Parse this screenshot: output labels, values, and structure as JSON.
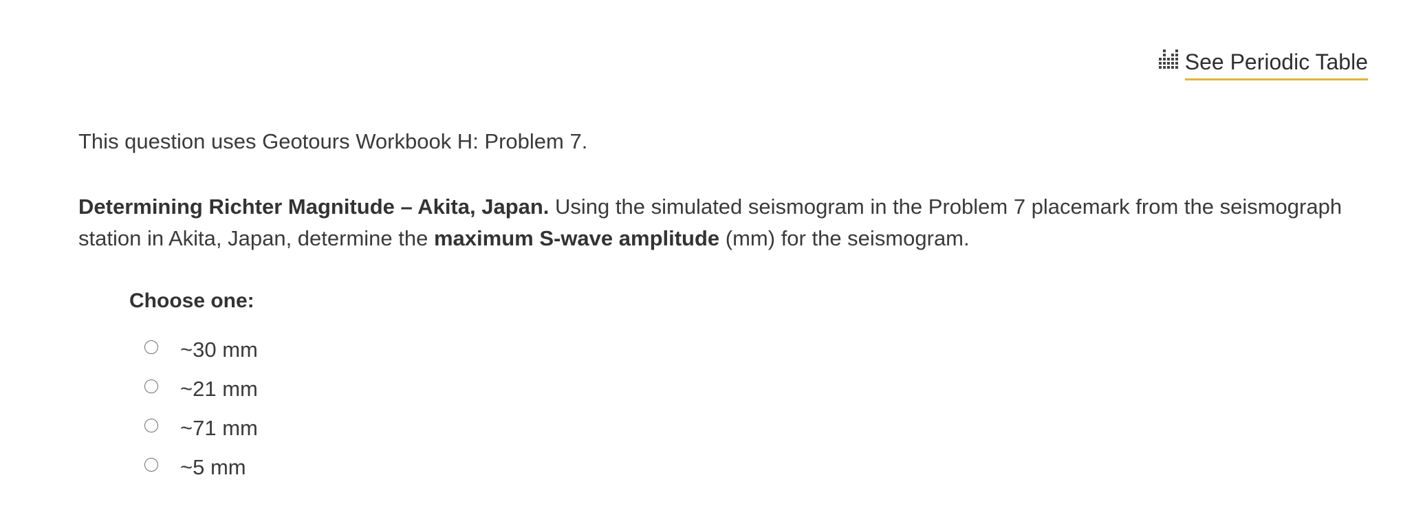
{
  "header": {
    "periodic_table_link": "See Periodic Table"
  },
  "question": {
    "intro": "This question uses Geotours Workbook H: Problem 7.",
    "title_bold": "Determining Richter Magnitude – Akita, Japan.",
    "text_part1": " Using the simulated seismogram in the Problem 7 placemark from the seismograph station in Akita, Japan, determine the ",
    "emphasis_bold": "maximum S-wave amplitude",
    "text_part2": " (mm) for the seismogram."
  },
  "choices": {
    "label": "Choose one:",
    "options": [
      {
        "label": "~30 mm"
      },
      {
        "label": "~21 mm"
      },
      {
        "label": "~71 mm"
      },
      {
        "label": "~5 mm"
      }
    ]
  },
  "colors": {
    "link_underline": "#e2b33c",
    "text": "#3a3a3a"
  }
}
